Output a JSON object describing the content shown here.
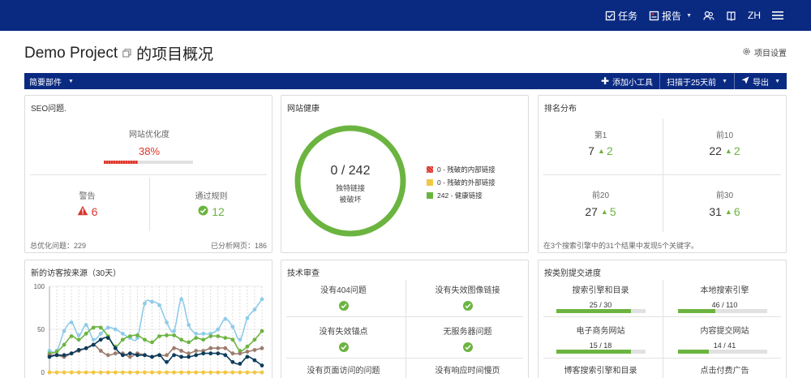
{
  "topnav": {
    "tasks_label": "任务",
    "reports_label": "报告",
    "lang_label": "ZH"
  },
  "page": {
    "project_name": "Demo Project",
    "title_suffix": "的项目概况",
    "settings_label": "项目设置"
  },
  "toolbar": {
    "widgets_label": "简要部件",
    "add_widget_label": "添加小工具",
    "scan_label": "扫描于25天前",
    "export_label": "导出"
  },
  "seo": {
    "title": "SEO问题.",
    "optimization_label": "网站优化度",
    "optimization_value": "38%",
    "optimization_fraction": 0.38,
    "warnings_label": "警告",
    "warnings_value": "6",
    "passed_label": "通过规则",
    "passed_value": "12",
    "total_issues_label": "总优化问题：",
    "total_issues_value": "229",
    "pages_label": "已分析网页：",
    "pages_value": "186"
  },
  "health": {
    "title": "网站健康",
    "ratio": "0 / 242",
    "caption_line1": "独特链接",
    "caption_line2": "被破坏",
    "legend": [
      {
        "label": "0 - 残破的内部链接",
        "swatch": "red"
      },
      {
        "label": "0 - 残破的外部链接",
        "swatch": "yellow"
      },
      {
        "label": "242 - 健康链接",
        "swatch": "green"
      }
    ]
  },
  "ranking": {
    "title": "排名分布",
    "cells": [
      {
        "label": "第1",
        "value": "7",
        "change": "2"
      },
      {
        "label": "前10",
        "value": "22",
        "change": "2"
      },
      {
        "label": "前20",
        "value": "27",
        "change": "5"
      },
      {
        "label": "前30",
        "value": "31",
        "change": "6"
      }
    ],
    "footer": "在3个搜索引擎中的31个结果中发现5个关键字。"
  },
  "visitors": {
    "title": "新的访客按来源（30天）"
  },
  "chart_data": {
    "type": "line",
    "yticks": [
      "100",
      "50",
      "0"
    ],
    "ylim": [
      0,
      100
    ],
    "series": [
      {
        "color": "#8fcbe8",
        "values": [
          25,
          25,
          48,
          58,
          43,
          55,
          38,
          45,
          52,
          50,
          45,
          40,
          40,
          80,
          82,
          78,
          58,
          48,
          85,
          55,
          45,
          45,
          45,
          50,
          62,
          53,
          38,
          63,
          73,
          85
        ]
      },
      {
        "color": "#6cb440",
        "values": [
          22,
          24,
          32,
          42,
          38,
          45,
          52,
          52,
          42,
          30,
          38,
          42,
          43,
          38,
          35,
          42,
          43,
          43,
          38,
          35,
          40,
          38,
          42,
          42,
          40,
          38,
          25,
          30,
          38,
          48
        ]
      },
      {
        "color": "#9c7c6e",
        "values": [
          20,
          20,
          18,
          22,
          25,
          28,
          32,
          25,
          20,
          22,
          22,
          18,
          22,
          20,
          18,
          20,
          20,
          28,
          25,
          22,
          25,
          25,
          28,
          28,
          28,
          22,
          22,
          24,
          26,
          28
        ]
      },
      {
        "color": "#0c3b5c",
        "values": [
          18,
          20,
          20,
          22,
          26,
          28,
          32,
          38,
          40,
          28,
          20,
          22,
          20,
          20,
          18,
          20,
          12,
          20,
          18,
          18,
          20,
          22,
          22,
          22,
          20,
          12,
          10,
          18,
          14,
          8
        ]
      },
      {
        "color": "#f2c744",
        "values": [
          0,
          0,
          0,
          0,
          0,
          0,
          0,
          0,
          0,
          0,
          0,
          0,
          0,
          0,
          0,
          0,
          0,
          0,
          0,
          0,
          0,
          0,
          0,
          0,
          0,
          0,
          0,
          0,
          0,
          0
        ]
      }
    ]
  },
  "tech": {
    "title": "技术审查",
    "cells": [
      {
        "label": "没有404问题"
      },
      {
        "label": "没有失效图像链接"
      },
      {
        "label": "没有失效锚点"
      },
      {
        "label": "无服务器问题"
      },
      {
        "label": "没有页面访问的问题"
      },
      {
        "label": "没有响应时间慢页"
      }
    ]
  },
  "submission": {
    "title": "按类别提交进度",
    "cells": [
      {
        "label": "搜索引擎和目录",
        "progress": "25 / 30",
        "fraction": 0.833
      },
      {
        "label": "本地搜索引擎",
        "progress": "46 / 110",
        "fraction": 0.418
      },
      {
        "label": "电子商务网站",
        "progress": "15 / 18",
        "fraction": 0.833
      },
      {
        "label": "内容提交网站",
        "progress": "14 / 41",
        "fraction": 0.341
      },
      {
        "label": "博客搜索引擎和目录",
        "progress": "",
        "fraction": 0
      },
      {
        "label": "点击付费广告",
        "progress": "",
        "fraction": 0
      }
    ]
  },
  "colors": {
    "brand": "#0a2a82",
    "warning": "#d9362c",
    "success": "#6cb440"
  }
}
